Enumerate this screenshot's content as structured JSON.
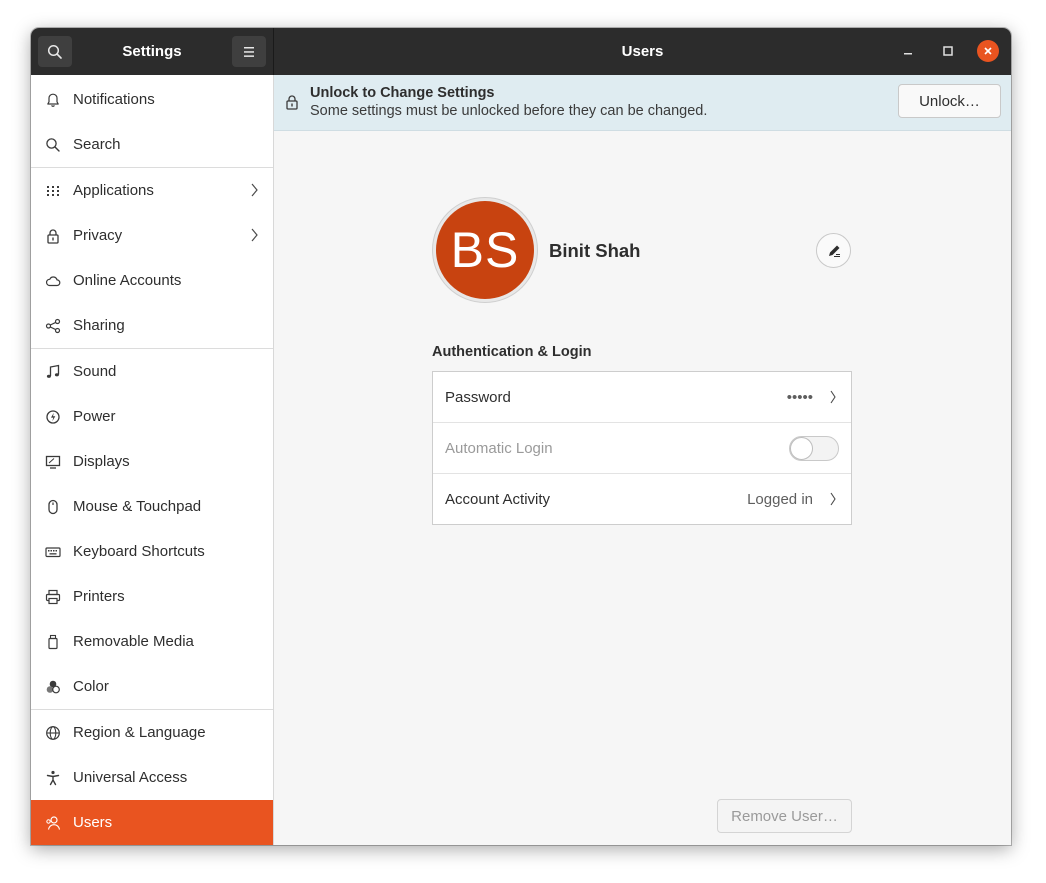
{
  "titlebar": {
    "left_title": "Settings",
    "main_title": "Users"
  },
  "sidebar": {
    "items": [
      {
        "label": "Notifications",
        "icon": "bell-icon"
      },
      {
        "label": "Search",
        "icon": "search-icon"
      },
      {
        "label": "Applications",
        "icon": "apps-grid-icon"
      },
      {
        "label": "Privacy",
        "icon": "lock-icon"
      },
      {
        "label": "Online Accounts",
        "icon": "cloud-icon"
      },
      {
        "label": "Sharing",
        "icon": "share-icon"
      },
      {
        "label": "Sound",
        "icon": "music-note-icon"
      },
      {
        "label": "Power",
        "icon": "power-icon"
      },
      {
        "label": "Displays",
        "icon": "display-icon"
      },
      {
        "label": "Mouse & Touchpad",
        "icon": "mouse-icon"
      },
      {
        "label": "Keyboard Shortcuts",
        "icon": "keyboard-icon"
      },
      {
        "label": "Printers",
        "icon": "printer-icon"
      },
      {
        "label": "Removable Media",
        "icon": "removable-media-icon"
      },
      {
        "label": "Color",
        "icon": "color-icon"
      },
      {
        "label": "Region & Language",
        "icon": "globe-icon"
      },
      {
        "label": "Universal Access",
        "icon": "accessibility-icon"
      },
      {
        "label": "Users",
        "icon": "users-icon"
      }
    ],
    "active": "Users"
  },
  "infobar": {
    "title": "Unlock to Change Settings",
    "subtitle": "Some settings must be unlocked before they can be changed.",
    "unlock_label": "Unlock…"
  },
  "user": {
    "initials": "BS",
    "name": "Binit Shah",
    "avatar_color": "#c84310"
  },
  "auth": {
    "section_title": "Authentication & Login",
    "password_label": "Password",
    "password_value": "•••••",
    "auto_login_label": "Automatic Login",
    "auto_login_enabled": false,
    "activity_label": "Account Activity",
    "activity_value": "Logged in"
  },
  "remove_user_label": "Remove User…",
  "colors": {
    "accent": "#e95420",
    "titlebar": "#2c2c2c",
    "infobar": "#dfecf1"
  }
}
